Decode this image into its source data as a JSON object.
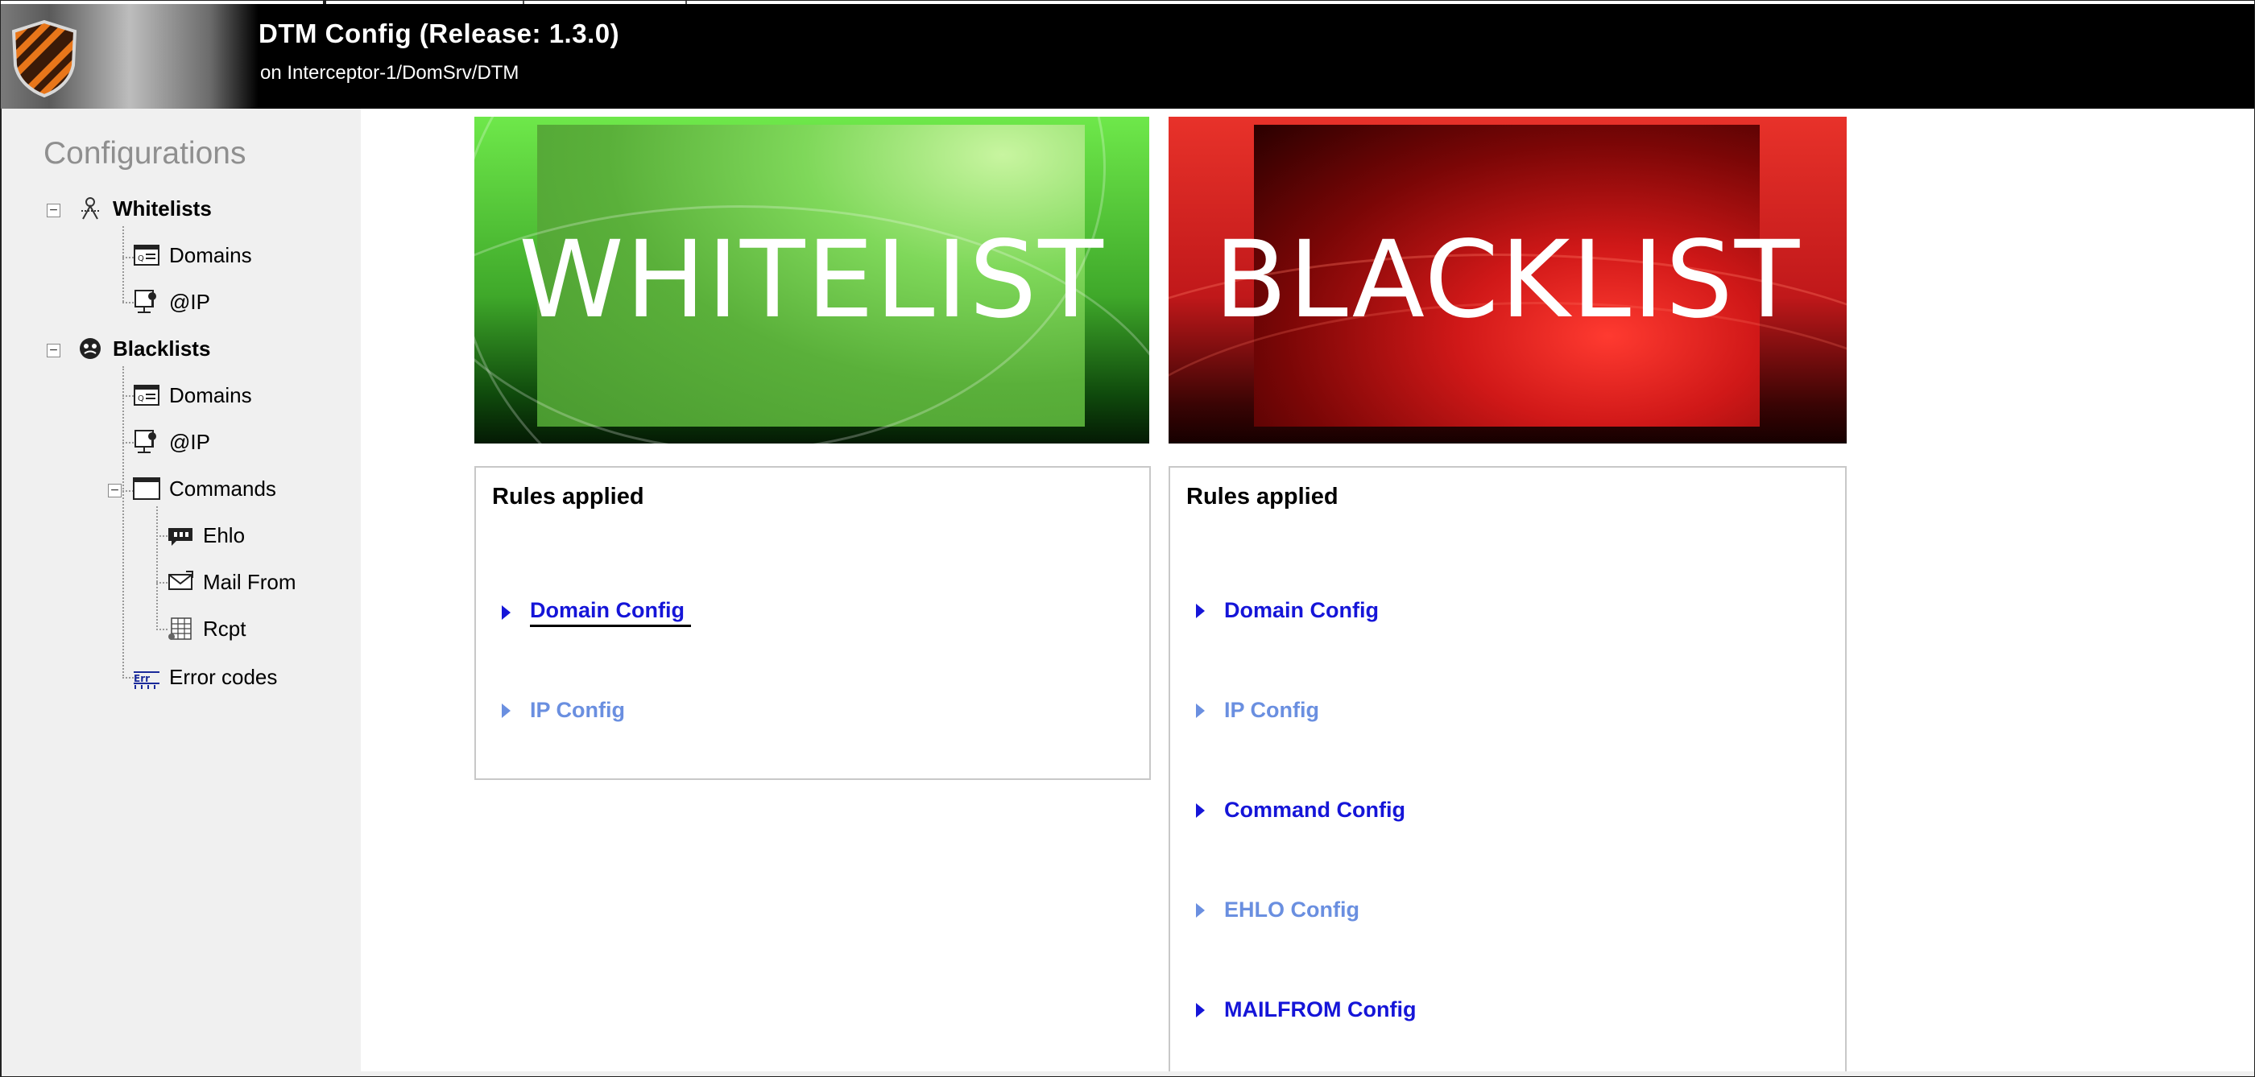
{
  "header": {
    "title": "DTM Config (Release: 1.3.0)",
    "subtitle": "on Interceptor-1/DomSrv/DTM"
  },
  "sidebar": {
    "title": "Configurations",
    "whitelists": {
      "label": "Whitelists",
      "toggle": "−",
      "items": [
        {
          "label": "Domains",
          "icon": "domain-icon"
        },
        {
          "label": "@IP",
          "icon": "ip-icon"
        }
      ]
    },
    "blacklists": {
      "label": "Blacklists",
      "toggle": "−",
      "items": [
        {
          "label": "Domains",
          "icon": "domain-icon"
        },
        {
          "label": "@IP",
          "icon": "ip-icon"
        }
      ],
      "commands": {
        "label": "Commands",
        "toggle": "−",
        "items": [
          {
            "label": "Ehlo",
            "icon": "ehlo-icon"
          },
          {
            "label": "Mail From",
            "icon": "mail-icon"
          },
          {
            "label": "Rcpt",
            "icon": "rcpt-icon"
          }
        ]
      },
      "error_codes": {
        "label": "Error codes",
        "icon": "error-codes-icon"
      }
    }
  },
  "banners": {
    "whitelist": "WHITELIST",
    "blacklist": "BLACKLIST"
  },
  "whitelist_panel": {
    "title": "Rules applied",
    "links": [
      {
        "label": "Domain Config",
        "state": "active"
      },
      {
        "label": "IP Config",
        "state": "inactive"
      }
    ]
  },
  "blacklist_panel": {
    "title": "Rules applied",
    "links": [
      {
        "label": "Domain Config",
        "state": "active"
      },
      {
        "label": "IP Config",
        "state": "inactive"
      },
      {
        "label": "Command Config",
        "state": "active"
      },
      {
        "label": "EHLO Config",
        "state": "inactive"
      },
      {
        "label": "MAILFROM Config",
        "state": "active"
      }
    ]
  },
  "colors": {
    "link_active": "#1515d8",
    "link_inactive": "#6a8fe0",
    "header_bg": "#000000",
    "sidebar_bg": "#f0f0f0"
  }
}
